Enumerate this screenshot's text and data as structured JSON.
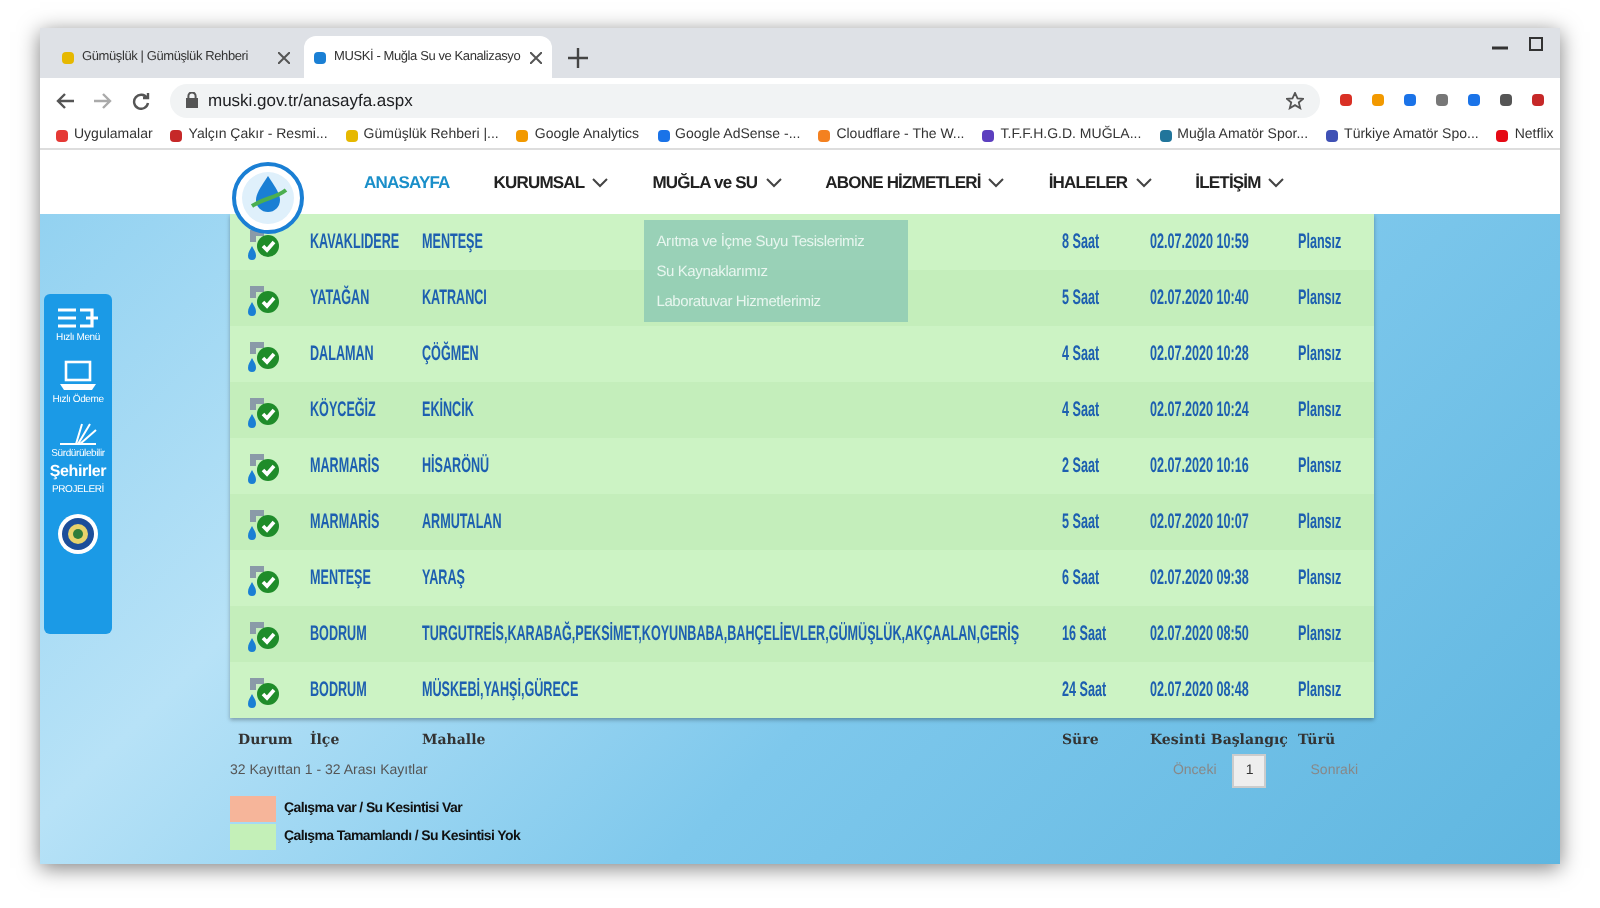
{
  "browser": {
    "tabs": [
      {
        "title": "Gümüşlük | Gümüşlük Rehberi",
        "selected": false
      },
      {
        "title": "MUSKİ - Muğla Su ve Kanalizasyo",
        "selected": true
      }
    ],
    "url": "muski.gov.tr/anasayfa.aspx",
    "bookmarks": [
      "Uygulamalar",
      "Yalçın Çakır - Resmi...",
      "Gümüşlük Rehberi |...",
      "Google Analytics",
      "Google AdSense -...",
      "Cloudflare - The W...",
      "T.F.F.H.G.D. MUĞLA...",
      "Muğla Amatör Spor...",
      "Türkiye Amatör Spo...",
      "Netflix"
    ]
  },
  "nav": {
    "items": [
      {
        "label": "ANASAYFA",
        "selected": true,
        "has_menu": false
      },
      {
        "label": "KURUMSAL",
        "selected": false,
        "has_menu": true
      },
      {
        "label": "MUĞLA ve SU",
        "selected": false,
        "has_menu": true,
        "submenu": [
          "Arıtma ve İçme Suyu Tesislerimiz",
          "Su Kaynaklarımız",
          "Laboratuvar Hizmetlerimiz"
        ]
      },
      {
        "label": "ABONE HİZMETLERİ",
        "selected": false,
        "has_menu": true
      },
      {
        "label": "İHALELER",
        "selected": false,
        "has_menu": true
      },
      {
        "label": "İLETİŞİM",
        "selected": false,
        "has_menu": true
      }
    ]
  },
  "sidebar": {
    "items": [
      {
        "kind": "menu",
        "label": "Hızlı Menü"
      },
      {
        "kind": "payment",
        "label": "Hızlı Ödeme"
      },
      {
        "kind": "project",
        "lines": [
          "Sürdürülebilir",
          "Şehirler",
          "PROJELERİ"
        ]
      },
      {
        "kind": "seal"
      }
    ]
  },
  "table": {
    "columns": [
      "Durum",
      "İlçe",
      "Mahalle",
      "Süre",
      "Kesinti Başlangıç",
      "Türü"
    ],
    "rows": [
      {
        "ilce": "KAVAKLIDERE",
        "mahalle": "MENTEŞE",
        "sure": "8 Saat",
        "baslangic": "02.07.2020 10:59",
        "tur": "Plansız"
      },
      {
        "ilce": "YATAĞAN",
        "mahalle": "KATRANCI",
        "sure": "5 Saat",
        "baslangic": "02.07.2020 10:40",
        "tur": "Plansız"
      },
      {
        "ilce": "DALAMAN",
        "mahalle": "ÇÖĞMEN",
        "sure": "4 Saat",
        "baslangic": "02.07.2020 10:28",
        "tur": "Plansız"
      },
      {
        "ilce": "KÖYCEĞİZ",
        "mahalle": "EKİNCİK",
        "sure": "4 Saat",
        "baslangic": "02.07.2020 10:24",
        "tur": "Plansız"
      },
      {
        "ilce": "MARMARİS",
        "mahalle": "HİSARÖNÜ",
        "sure": "2 Saat",
        "baslangic": "02.07.2020 10:16",
        "tur": "Plansız"
      },
      {
        "ilce": "MARMARİS",
        "mahalle": "ARMUTALAN",
        "sure": "5 Saat",
        "baslangic": "02.07.2020 10:07",
        "tur": "Plansız"
      },
      {
        "ilce": "MENTEŞE",
        "mahalle": "YARAŞ",
        "sure": "6 Saat",
        "baslangic": "02.07.2020 09:38",
        "tur": "Plansız"
      },
      {
        "ilce": "BODRUM",
        "mahalle": "TURGUTREİS,KARABAĞ,PEKSİMET,KOYUNBABA,BAHÇELİEVLER,GÜMÜŞLÜK,AKÇAALAN,GERİŞ",
        "sure": "16 Saat",
        "baslangic": "02.07.2020 08:50",
        "tur": "Plansız"
      },
      {
        "ilce": "BODRUM",
        "mahalle": "MÜSKEBİ,YAHŞİ,GÜRECE",
        "sure": "24 Saat",
        "baslangic": "02.07.2020 08:48",
        "tur": "Plansız"
      }
    ]
  },
  "record_info": "32 Kayıttan 1 - 32 Arası Kayıtlar",
  "pager": {
    "prev": "Önceki",
    "pages": [
      {
        "label": "1",
        "selected": true
      }
    ],
    "next": "Sonraki"
  },
  "legend": [
    {
      "label": "Çalışma var / Su Kesintisi Var",
      "color": "#f6b59a"
    },
    {
      "label": "Çalışma Tamamlandı / Su Kesintisi Yok",
      "color": "#c4f0b8"
    }
  ]
}
